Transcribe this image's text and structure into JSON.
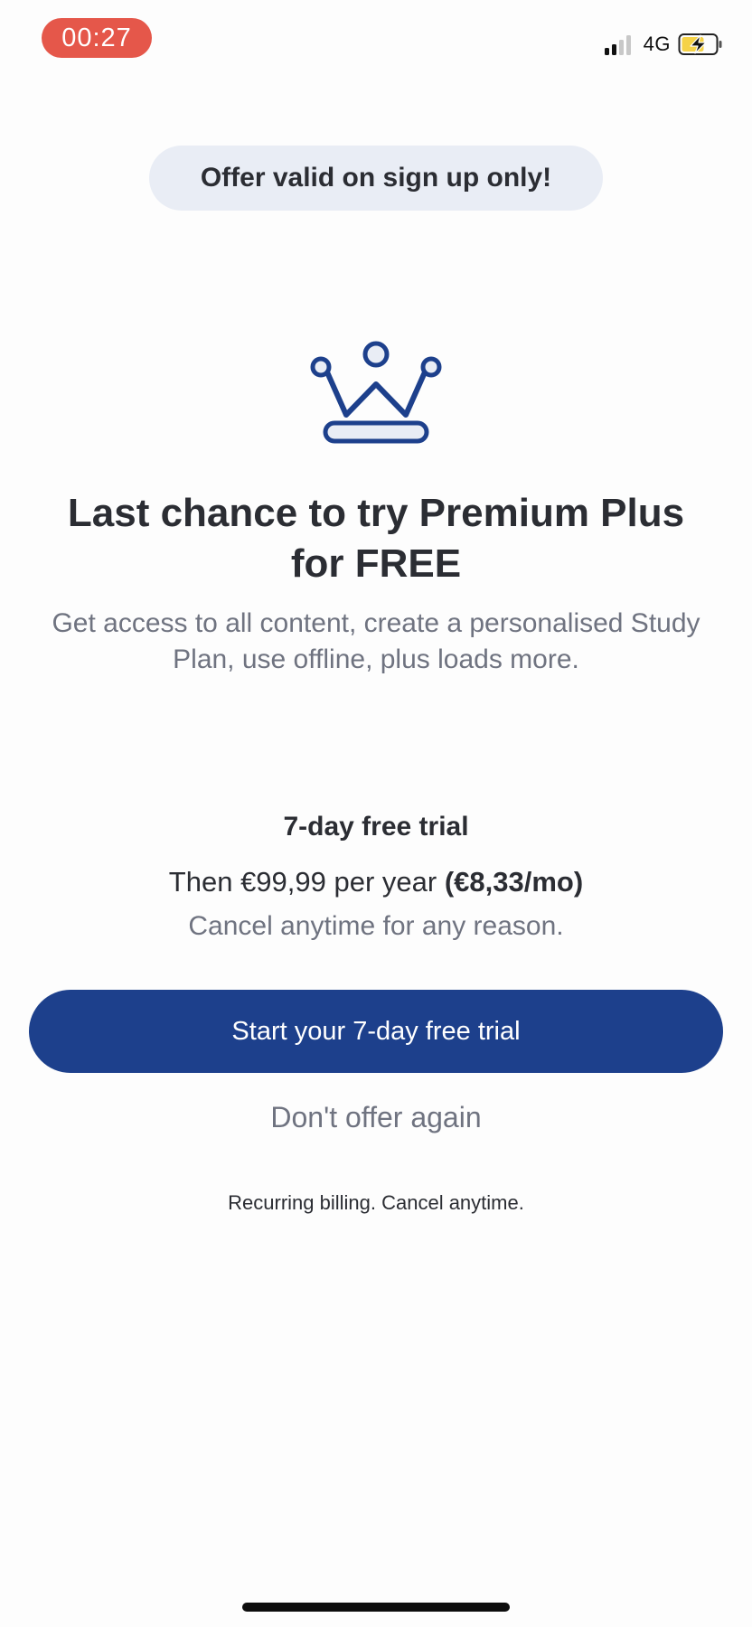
{
  "status_bar": {
    "time": "00:27",
    "network": "4G",
    "signal_icon": "cellular-signal-icon",
    "battery_icon": "battery-charging-icon",
    "colors": {
      "time_pill": "#e5574a",
      "battery_fill": "#f5d247"
    }
  },
  "offer_banner": {
    "text": "Offer valid on sign up only!"
  },
  "hero": {
    "icon": "crown-icon",
    "headline": "Last chance to try Premium Plus for FREE",
    "subtitle": "Get access to all content, create a personalised Study Plan, use offline, plus loads more."
  },
  "pricing": {
    "trial_title": "7-day free trial",
    "price_prefix": "Then €99,99 per year ",
    "price_monthly": "(€8,33/mo)",
    "cancel_note": "Cancel anytime for any reason."
  },
  "actions": {
    "cta_label": "Start your 7-day free trial",
    "dismiss_label": "Don't offer again"
  },
  "footer": {
    "billing_note": "Recurring billing. Cancel anytime."
  },
  "theme": {
    "primary": "#1d408c",
    "crown_stroke": "#1d408c",
    "crown_fill": "#e9edf5",
    "pill_bg": "#e9edf5",
    "muted_text": "#6f7380",
    "text": "#2b2d33"
  }
}
